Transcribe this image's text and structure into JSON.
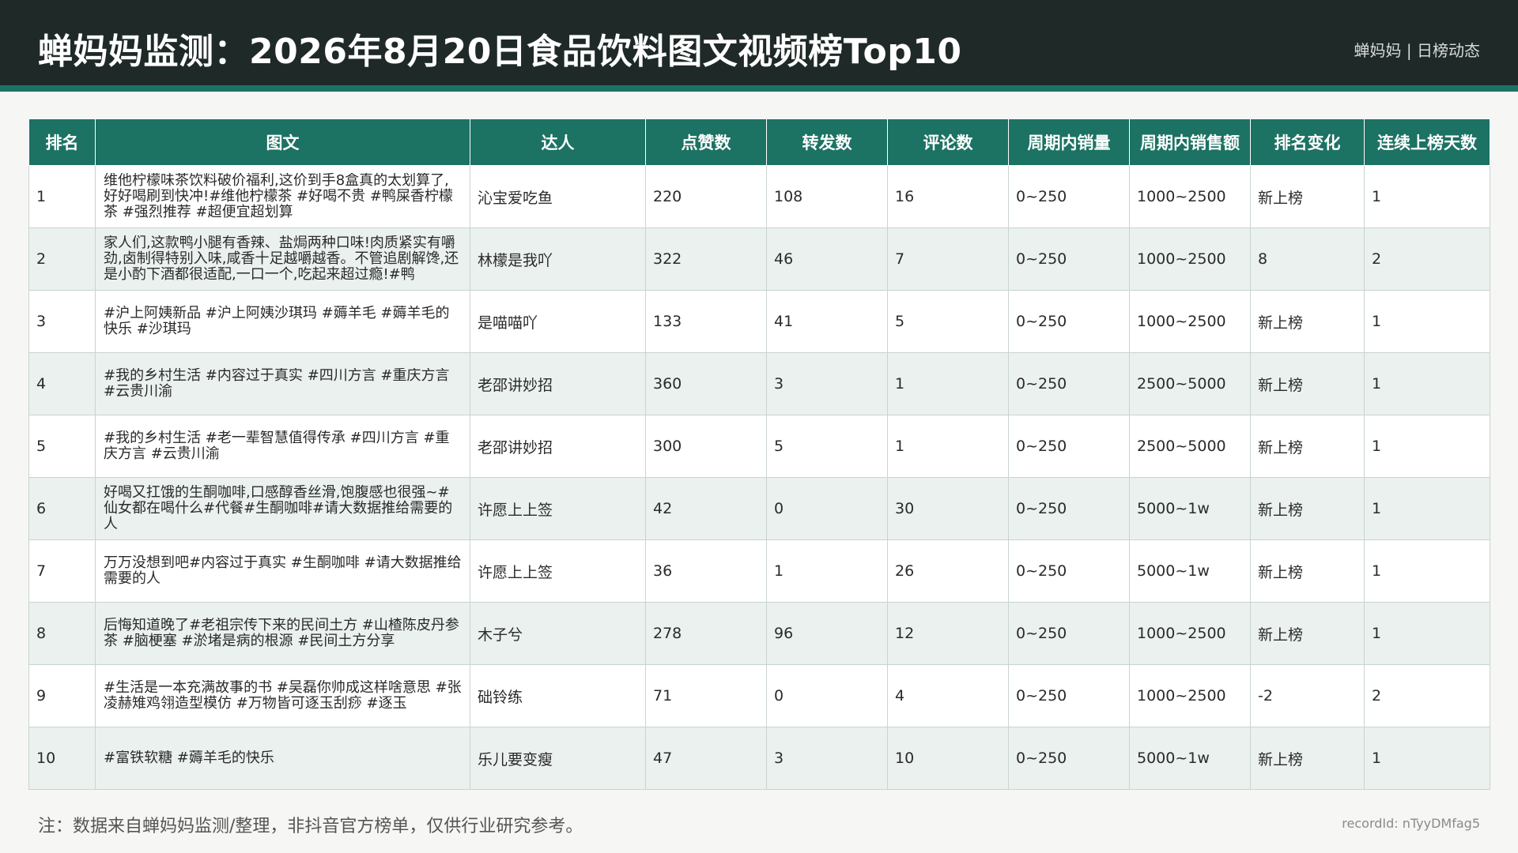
{
  "header": {
    "title": "蝉妈妈监测：2026年8月20日食品饮料图文视频榜Top10",
    "brand": "蝉妈妈 | 日榜动态"
  },
  "colors": {
    "header_bg": "#1f2a28",
    "accent": "#1c7263",
    "row_alt": "#eaf1ee"
  },
  "table": {
    "columns": [
      "排名",
      "图文",
      "达人",
      "点赞数",
      "转发数",
      "评论数",
      "周期内销量",
      "周期内销售额",
      "排名变化",
      "连续上榜天数"
    ],
    "rows": [
      {
        "rank": "1",
        "content": "维他柠檬味茶饮料破价福利,这价到手8盒真的太划算了,好好喝刷到快冲!#维他柠檬茶 #好喝不贵 #鸭屎香柠檬茶 #强烈推荐 #超便宜超划算",
        "influencer": "沁宝爱吃鱼",
        "likes": "220",
        "shares": "108",
        "comments": "16",
        "sales_volume": "0~250",
        "sales_amount": "1000~2500",
        "rank_change": "新上榜",
        "days": "1"
      },
      {
        "rank": "2",
        "content": "家人们,这款鸭小腿有香辣、盐焗两种口味!肉质紧实有嚼劲,卤制得特别入味,咸香十足越嚼越香。不管追剧解馋,还是小酌下酒都很适配,一口一个,吃起来超过瘾!#鸭",
        "influencer": "林檬是我吖",
        "likes": "322",
        "shares": "46",
        "comments": "7",
        "sales_volume": "0~250",
        "sales_amount": "1000~2500",
        "rank_change": "8",
        "days": "2"
      },
      {
        "rank": "3",
        "content": "#沪上阿姨新品 #沪上阿姨沙琪玛 #薅羊毛 #薅羊毛的快乐 #沙琪玛",
        "influencer": "是喵喵吖",
        "likes": "133",
        "shares": "41",
        "comments": "5",
        "sales_volume": "0~250",
        "sales_amount": "1000~2500",
        "rank_change": "新上榜",
        "days": "1"
      },
      {
        "rank": "4",
        "content": "#我的乡村生活 #内容过于真实 #四川方言 #重庆方言 #云贵川渝",
        "influencer": "老邵讲妙招",
        "likes": "360",
        "shares": "3",
        "comments": "1",
        "sales_volume": "0~250",
        "sales_amount": "2500~5000",
        "rank_change": "新上榜",
        "days": "1"
      },
      {
        "rank": "5",
        "content": "#我的乡村生活 #老一辈智慧值得传承 #四川方言 #重庆方言 #云贵川渝",
        "influencer": "老邵讲妙招",
        "likes": "300",
        "shares": "5",
        "comments": "1",
        "sales_volume": "0~250",
        "sales_amount": "2500~5000",
        "rank_change": "新上榜",
        "days": "1"
      },
      {
        "rank": "6",
        "content": "好喝又扛饿的生酮咖啡,口感醇香丝滑,饱腹感也很强~#仙女都在喝什么#代餐#生酮咖啡#请大数据推给需要的人",
        "influencer": "许愿上上签",
        "likes": "42",
        "shares": "0",
        "comments": "30",
        "sales_volume": "0~250",
        "sales_amount": "5000~1w",
        "rank_change": "新上榜",
        "days": "1"
      },
      {
        "rank": "7",
        "content": "万万没想到吧#内容过于真实 #生酮咖啡 #请大数据推给需要的人",
        "influencer": "许愿上上签",
        "likes": "36",
        "shares": "1",
        "comments": "26",
        "sales_volume": "0~250",
        "sales_amount": "5000~1w",
        "rank_change": "新上榜",
        "days": "1"
      },
      {
        "rank": "8",
        "content": "后悔知道晚了#老祖宗传下来的民间土方 #山楂陈皮丹参茶 #脑梗塞 #淤堵是病的根源 #民间土方分享",
        "influencer": "木子兮",
        "likes": "278",
        "shares": "96",
        "comments": "12",
        "sales_volume": "0~250",
        "sales_amount": "1000~2500",
        "rank_change": "新上榜",
        "days": "1"
      },
      {
        "rank": "9",
        "content": "#生活是一本充满故事的书 #吴磊你帅成这样啥意思 #张凌赫雉鸡翎造型模仿 #万物皆可逐玉刮痧 #逐玉",
        "influencer": "础铃练",
        "likes": "71",
        "shares": "0",
        "comments": "4",
        "sales_volume": "0~250",
        "sales_amount": "1000~2500",
        "rank_change": "-2",
        "days": "2"
      },
      {
        "rank": "10",
        "content": "#富铁软糖 #薅羊毛的快乐",
        "influencer": "乐儿要变瘦",
        "likes": "47",
        "shares": "3",
        "comments": "10",
        "sales_volume": "0~250",
        "sales_amount": "5000~1w",
        "rank_change": "新上榜",
        "days": "1"
      }
    ]
  },
  "footer": {
    "note": "注：数据来自蝉妈妈监测/整理，非抖音官方榜单，仅供行业研究参考。",
    "record_id": "recordId: nTyyDMfag5"
  }
}
